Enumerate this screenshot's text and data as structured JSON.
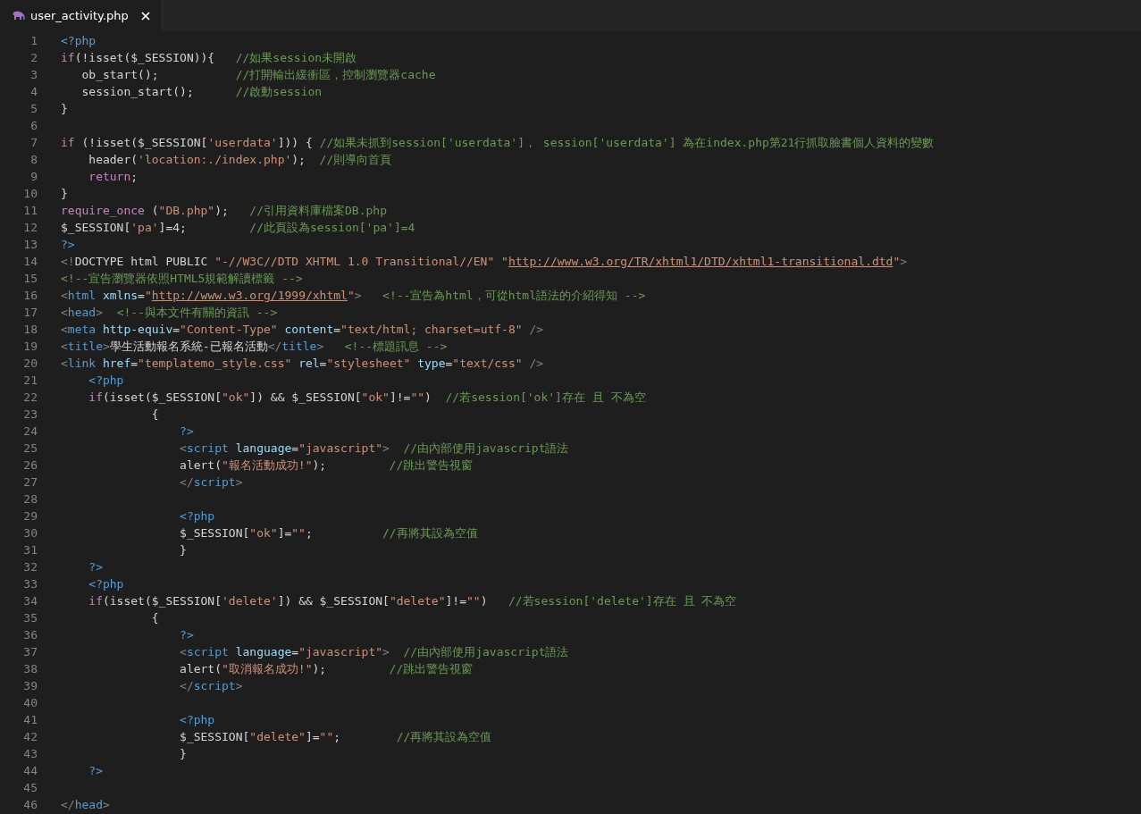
{
  "tab": {
    "title": "user_activity.php",
    "selected": true
  },
  "editor": {
    "lines": [
      {
        "number": "1",
        "tokens": [
          {
            "kind": "tag",
            "text": "<?php"
          }
        ]
      },
      {
        "number": "2",
        "tokens": [
          {
            "kind": "keyword",
            "text": "if"
          },
          {
            "kind": "plain",
            "text": "(!isset($_SESSION)){   "
          },
          {
            "kind": "comment",
            "text": "//如果session未開啟"
          }
        ]
      },
      {
        "number": "3",
        "tokens": [
          {
            "kind": "plain",
            "text": "   ob_start();           "
          },
          {
            "kind": "comment",
            "text": "//打開輸出緩衝區，控制瀏覽器cache"
          }
        ]
      },
      {
        "number": "4",
        "tokens": [
          {
            "kind": "plain",
            "text": "   session_start();      "
          },
          {
            "kind": "comment",
            "text": "//啟動session"
          }
        ]
      },
      {
        "number": "5",
        "tokens": [
          {
            "kind": "plain",
            "text": "}"
          }
        ]
      },
      {
        "number": "6"
      },
      {
        "number": "7",
        "tokens": [
          {
            "kind": "keyword",
            "text": "if"
          },
          {
            "kind": "plain",
            "text": " (!isset($_SESSION["
          },
          {
            "kind": "string",
            "text": "'userdata'"
          },
          {
            "kind": "plain",
            "text": "])) { "
          },
          {
            "kind": "comment",
            "text": "//如果未抓到session['userdata']， session['userdata'] 為在index.php第21行抓取臉書個人資料的變數"
          }
        ]
      },
      {
        "number": "8",
        "tokens": [
          {
            "kind": "plain",
            "text": "    header("
          },
          {
            "kind": "string",
            "text": "'location:./index.php'"
          },
          {
            "kind": "plain",
            "text": ");  "
          },
          {
            "kind": "comment",
            "text": "//則導向首頁"
          }
        ]
      },
      {
        "number": "9",
        "tokens": [
          {
            "kind": "keyword",
            "text": "    return"
          },
          {
            "kind": "plain",
            "text": ";"
          }
        ]
      },
      {
        "number": "10",
        "tokens": [
          {
            "kind": "plain",
            "text": "}"
          }
        ]
      },
      {
        "number": "11",
        "tokens": [
          {
            "kind": "keyword",
            "text": "require_once"
          },
          {
            "kind": "plain",
            "text": " ("
          },
          {
            "kind": "string",
            "text": "\"DB.php\""
          },
          {
            "kind": "plain",
            "text": ");   "
          },
          {
            "kind": "comment",
            "text": "//引用資料庫檔案DB.php"
          }
        ]
      },
      {
        "number": "12",
        "tokens": [
          {
            "kind": "plain",
            "text": "$_SESSION["
          },
          {
            "kind": "string",
            "text": "'pa'"
          },
          {
            "kind": "plain",
            "text": "]=4;         "
          },
          {
            "kind": "comment",
            "text": "//此頁設為session['pa']=4"
          }
        ]
      },
      {
        "number": "13",
        "tokens": [
          {
            "kind": "tag",
            "text": "?>"
          }
        ]
      },
      {
        "number": "14",
        "tokens": [
          {
            "kind": "punct",
            "text": "<!"
          },
          {
            "kind": "plain",
            "text": "DOCTYPE html PUBLIC "
          },
          {
            "kind": "string",
            "text": "\"-//W3C//DTD XHTML 1.0 Transitional//EN\" \""
          },
          {
            "kind": "link",
            "text": "http://www.w3.org/TR/xhtml1/DTD/xhtml1-transitional.dtd"
          },
          {
            "kind": "string",
            "text": "\""
          },
          {
            "kind": "punct",
            "text": ">"
          }
        ]
      },
      {
        "number": "15",
        "tokens": [
          {
            "kind": "comment",
            "text": "<!--宣告瀏覽器依照HTML5規範解讀標籤 -->"
          }
        ]
      },
      {
        "number": "16",
        "tokens": [
          {
            "kind": "punct",
            "text": "<"
          },
          {
            "kind": "tag",
            "text": "html "
          },
          {
            "kind": "attribute",
            "text": "xmlns"
          },
          {
            "kind": "plain",
            "text": "="
          },
          {
            "kind": "string",
            "text": "\""
          },
          {
            "kind": "link",
            "text": "http://www.w3.org/1999/xhtml"
          },
          {
            "kind": "string",
            "text": "\""
          },
          {
            "kind": "punct",
            "text": ">   "
          },
          {
            "kind": "comment",
            "text": "<!--宣告為html，可從html語法的介紹得知 -->"
          }
        ]
      },
      {
        "number": "17",
        "tokens": [
          {
            "kind": "punct",
            "text": "<"
          },
          {
            "kind": "tag",
            "text": "head"
          },
          {
            "kind": "punct",
            "text": ">  "
          },
          {
            "kind": "comment",
            "text": "<!--與本文件有關的資訊 -->"
          }
        ]
      },
      {
        "number": "18",
        "tokens": [
          {
            "kind": "punct",
            "text": "<"
          },
          {
            "kind": "tag",
            "text": "meta "
          },
          {
            "kind": "attribute",
            "text": "http-equiv"
          },
          {
            "kind": "plain",
            "text": "="
          },
          {
            "kind": "string",
            "text": "\"Content-Type\" "
          },
          {
            "kind": "attribute",
            "text": "content"
          },
          {
            "kind": "plain",
            "text": "="
          },
          {
            "kind": "string",
            "text": "\"text/html; charset=utf-8\" "
          },
          {
            "kind": "punct",
            "text": "/>"
          }
        ]
      },
      {
        "number": "19",
        "tokens": [
          {
            "kind": "punct",
            "text": "<"
          },
          {
            "kind": "tag",
            "text": "title"
          },
          {
            "kind": "punct",
            "text": ">"
          },
          {
            "kind": "plain",
            "text": "學生活動報名系統-已報名活動"
          },
          {
            "kind": "punct",
            "text": "</"
          },
          {
            "kind": "tag",
            "text": "title"
          },
          {
            "kind": "punct",
            "text": ">   "
          },
          {
            "kind": "comment",
            "text": "<!--標題訊息 -->"
          }
        ]
      },
      {
        "number": "20",
        "tokens": [
          {
            "kind": "punct",
            "text": "<"
          },
          {
            "kind": "tag",
            "text": "link "
          },
          {
            "kind": "attribute",
            "text": "href"
          },
          {
            "kind": "plain",
            "text": "="
          },
          {
            "kind": "string",
            "text": "\"templatemo_style.css\" "
          },
          {
            "kind": "attribute",
            "text": "rel"
          },
          {
            "kind": "plain",
            "text": "="
          },
          {
            "kind": "string",
            "text": "\"stylesheet\" "
          },
          {
            "kind": "attribute",
            "text": "type"
          },
          {
            "kind": "plain",
            "text": "="
          },
          {
            "kind": "string",
            "text": "\"text/css\" "
          },
          {
            "kind": "punct",
            "text": "/>"
          }
        ]
      },
      {
        "number": "21",
        "tokens": [
          {
            "kind": "tag",
            "text": "    <?php"
          }
        ]
      },
      {
        "number": "22",
        "tokens": [
          {
            "kind": "keyword",
            "text": "    if"
          },
          {
            "kind": "plain",
            "text": "(isset($_SESSION["
          },
          {
            "kind": "string",
            "text": "\"ok\""
          },
          {
            "kind": "plain",
            "text": "]) && $_SESSION["
          },
          {
            "kind": "string",
            "text": "\"ok\""
          },
          {
            "kind": "plain",
            "text": "]!="
          },
          {
            "kind": "string",
            "text": "\"\""
          },
          {
            "kind": "plain",
            "text": ")  "
          },
          {
            "kind": "comment",
            "text": "//若session['ok']存在 且 不為空"
          }
        ]
      },
      {
        "number": "23",
        "tokens": [
          {
            "kind": "plain",
            "text": "             {"
          }
        ]
      },
      {
        "number": "24",
        "tokens": [
          {
            "kind": "tag",
            "text": "                 ?>"
          }
        ]
      },
      {
        "number": "25",
        "tokens": [
          {
            "kind": "punct",
            "text": "                 <"
          },
          {
            "kind": "tag",
            "text": "script "
          },
          {
            "kind": "attribute",
            "text": "language"
          },
          {
            "kind": "plain",
            "text": "="
          },
          {
            "kind": "string",
            "text": "\"javascript\""
          },
          {
            "kind": "punct",
            "text": ">  "
          },
          {
            "kind": "comment",
            "text": "//由內部使用javascript語法"
          }
        ]
      },
      {
        "number": "26",
        "tokens": [
          {
            "kind": "plain",
            "text": "                 alert("
          },
          {
            "kind": "string",
            "text": "\"報名活動成功!\""
          },
          {
            "kind": "plain",
            "text": ");         "
          },
          {
            "kind": "comment",
            "text": "//跳出警告視窗"
          }
        ]
      },
      {
        "number": "27",
        "tokens": [
          {
            "kind": "punct",
            "text": "                 </"
          },
          {
            "kind": "tag",
            "text": "script"
          },
          {
            "kind": "punct",
            "text": ">"
          }
        ]
      },
      {
        "number": "28"
      },
      {
        "number": "29",
        "tokens": [
          {
            "kind": "tag",
            "text": "                 <?php"
          }
        ]
      },
      {
        "number": "30",
        "tokens": [
          {
            "kind": "plain",
            "text": "                 $_SESSION["
          },
          {
            "kind": "string",
            "text": "\"ok\""
          },
          {
            "kind": "plain",
            "text": "]="
          },
          {
            "kind": "string",
            "text": "\"\""
          },
          {
            "kind": "plain",
            "text": ";          "
          },
          {
            "kind": "comment",
            "text": "//再將其設為空值"
          }
        ]
      },
      {
        "number": "31",
        "tokens": [
          {
            "kind": "plain",
            "text": "                 }"
          }
        ]
      },
      {
        "number": "32",
        "tokens": [
          {
            "kind": "tag",
            "text": "    ?>"
          }
        ]
      },
      {
        "number": "33",
        "tokens": [
          {
            "kind": "tag",
            "text": "    <?php"
          }
        ]
      },
      {
        "number": "34",
        "tokens": [
          {
            "kind": "keyword",
            "text": "    if"
          },
          {
            "kind": "plain",
            "text": "(isset($_SESSION["
          },
          {
            "kind": "string",
            "text": "'delete'"
          },
          {
            "kind": "plain",
            "text": "]) && $_SESSION["
          },
          {
            "kind": "string",
            "text": "\"delete\""
          },
          {
            "kind": "plain",
            "text": "]!="
          },
          {
            "kind": "string",
            "text": "\"\""
          },
          {
            "kind": "plain",
            "text": ")   "
          },
          {
            "kind": "comment",
            "text": "//若session['delete']存在 且 不為空"
          }
        ]
      },
      {
        "number": "35",
        "tokens": [
          {
            "kind": "plain",
            "text": "             {"
          }
        ]
      },
      {
        "number": "36",
        "tokens": [
          {
            "kind": "tag",
            "text": "                 ?>"
          }
        ]
      },
      {
        "number": "37",
        "tokens": [
          {
            "kind": "punct",
            "text": "                 <"
          },
          {
            "kind": "tag",
            "text": "script "
          },
          {
            "kind": "attribute",
            "text": "language"
          },
          {
            "kind": "plain",
            "text": "="
          },
          {
            "kind": "string",
            "text": "\"javascript\""
          },
          {
            "kind": "punct",
            "text": ">  "
          },
          {
            "kind": "comment",
            "text": "//由內部使用javascript語法"
          }
        ]
      },
      {
        "number": "38",
        "tokens": [
          {
            "kind": "plain",
            "text": "                 alert("
          },
          {
            "kind": "string",
            "text": "\"取消報名成功!\""
          },
          {
            "kind": "plain",
            "text": ");         "
          },
          {
            "kind": "comment",
            "text": "//跳出警告視窗"
          }
        ]
      },
      {
        "number": "39",
        "tokens": [
          {
            "kind": "punct",
            "text": "                 </"
          },
          {
            "kind": "tag",
            "text": "script"
          },
          {
            "kind": "punct",
            "text": ">"
          }
        ]
      },
      {
        "number": "40"
      },
      {
        "number": "41",
        "tokens": [
          {
            "kind": "tag",
            "text": "                 <?php"
          }
        ]
      },
      {
        "number": "42",
        "tokens": [
          {
            "kind": "plain",
            "text": "                 $_SESSION["
          },
          {
            "kind": "string",
            "text": "\"delete\""
          },
          {
            "kind": "plain",
            "text": "]="
          },
          {
            "kind": "string",
            "text": "\"\""
          },
          {
            "kind": "plain",
            "text": ";        "
          },
          {
            "kind": "comment",
            "text": "//再將其設為空值"
          }
        ]
      },
      {
        "number": "43",
        "tokens": [
          {
            "kind": "plain",
            "text": "                 }"
          }
        ]
      },
      {
        "number": "44",
        "tokens": [
          {
            "kind": "tag",
            "text": "    ?>"
          }
        ]
      },
      {
        "number": "45"
      },
      {
        "number": "46",
        "tokens": [
          {
            "kind": "punct",
            "text": "</"
          },
          {
            "kind": "tag",
            "text": "head"
          },
          {
            "kind": "punct",
            "text": ">"
          }
        ]
      }
    ]
  }
}
